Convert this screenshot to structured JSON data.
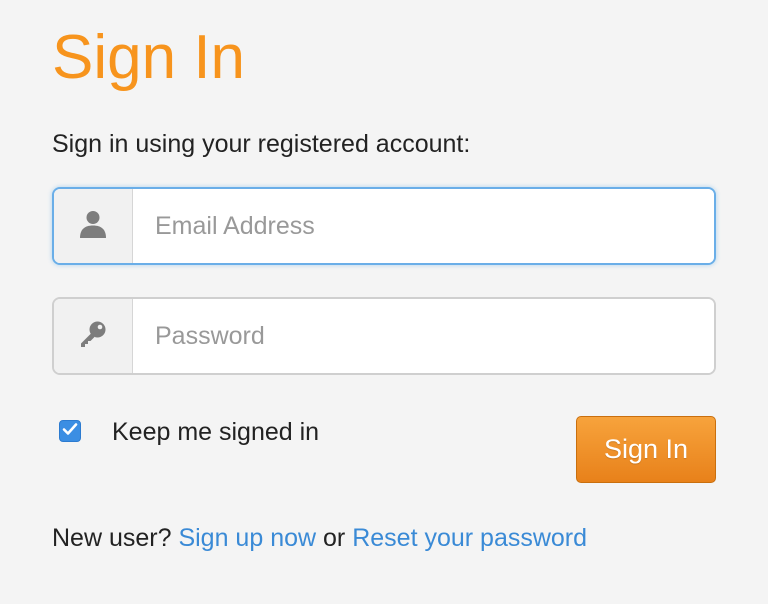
{
  "form": {
    "title": "Sign In",
    "subtitle": "Sign in using your registered account:",
    "email": {
      "placeholder": "Email Address",
      "value": "",
      "icon": "user-icon",
      "focused": true
    },
    "password": {
      "placeholder": "Password",
      "value": "",
      "icon": "key-icon"
    },
    "keep_signed_in": {
      "label": "Keep me signed in",
      "checked": true
    },
    "submit_label": "Sign In"
  },
  "footer": {
    "prefix": "New user?",
    "signup_link": "Sign up now",
    "separator": "or",
    "reset_link": "Reset your password"
  },
  "colors": {
    "accent": "#f7941d",
    "link": "#3a8ad6",
    "focus_border": "#6aaee8",
    "checkbox": "#3b8ee3"
  }
}
